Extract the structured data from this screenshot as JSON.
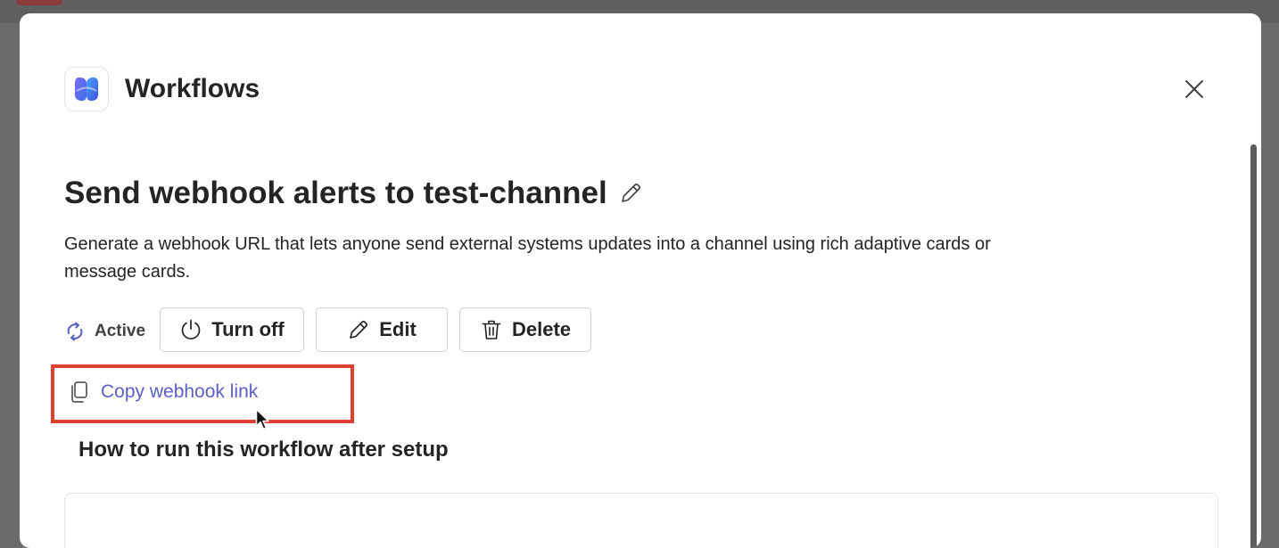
{
  "dialog": {
    "app_title": "Workflows",
    "icons": {
      "app": "workflows-logo-icon",
      "close": "close-icon"
    }
  },
  "workflow": {
    "title": "Send webhook alerts to test-channel",
    "description": "Generate a webhook URL that lets anyone send external systems updates into a channel using rich adaptive cards or message cards.",
    "status_label": "Active",
    "actions": {
      "turn_off": "Turn off",
      "edit": "Edit",
      "delete": "Delete"
    },
    "copy_link_label": "Copy webhook link"
  },
  "section": {
    "how_to_run_title": "How to run this workflow after setup"
  },
  "colors": {
    "accent": "#5b5fc7",
    "highlight": "#e0412e",
    "text": "#242424"
  }
}
